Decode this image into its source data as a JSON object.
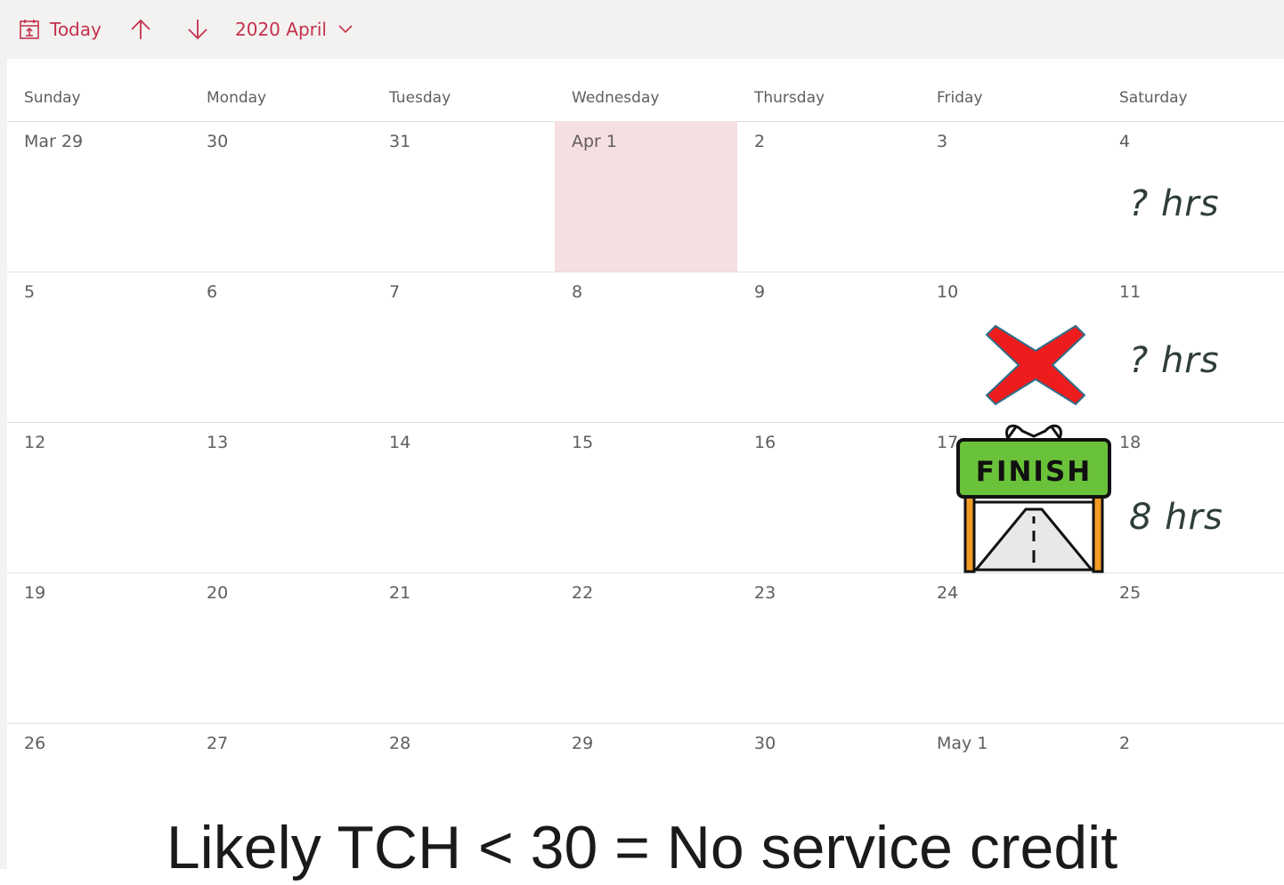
{
  "toolbar": {
    "today_label": "Today",
    "month_label": "2020 April"
  },
  "day_names": [
    "Sunday",
    "Monday",
    "Tuesday",
    "Wednesday",
    "Thursday",
    "Friday",
    "Saturday"
  ],
  "weeks": [
    [
      "Mar 29",
      "30",
      "31",
      "Apr 1",
      "2",
      "3",
      "4"
    ],
    [
      "5",
      "6",
      "7",
      "8",
      "9",
      "10",
      "11"
    ],
    [
      "12",
      "13",
      "14",
      "15",
      "16",
      "17",
      "18"
    ],
    [
      "19",
      "20",
      "21",
      "22",
      "23",
      "24",
      "25"
    ],
    [
      "26",
      "27",
      "28",
      "29",
      "30",
      "May 1",
      "2"
    ]
  ],
  "annotations": {
    "week1_hours": "? hrs",
    "week2_hours": "? hrs",
    "week3_hours": "8 hrs",
    "finish_sign": "FINISH"
  },
  "caption": "Likely TCH < 30 = No service credit",
  "colors": {
    "accent": "#c4314b",
    "today_cell": "#f5dfe2",
    "cross": "#ee1c1c",
    "finish_green": "#6ac23b"
  }
}
